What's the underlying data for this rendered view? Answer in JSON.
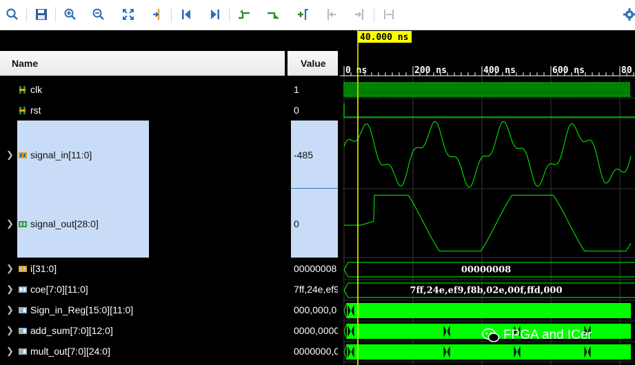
{
  "toolbar": {
    "buttons": [
      {
        "name": "search-icon"
      },
      {
        "name": "save-icon"
      },
      {
        "name": "zoom-in-icon"
      },
      {
        "name": "zoom-out-icon"
      },
      {
        "name": "zoom-fit-icon"
      },
      {
        "name": "go-to-cursor-icon"
      },
      {
        "name": "go-to-start-icon"
      },
      {
        "name": "go-to-end-icon"
      },
      {
        "name": "previous-transition-icon"
      },
      {
        "name": "next-transition-icon"
      },
      {
        "name": "add-marker-icon"
      },
      {
        "name": "previous-marker-icon"
      },
      {
        "name": "next-marker-icon"
      },
      {
        "name": "swap-cursors-icon"
      }
    ],
    "settings_icon": "gear-icon"
  },
  "columns": {
    "name_header": "Name",
    "value_header": "Value"
  },
  "signals": [
    {
      "label": "clk",
      "value": "1",
      "expandable": false,
      "icon": "bit-signal-icon"
    },
    {
      "label": "rst",
      "value": "0",
      "expandable": false,
      "icon": "bit-signal-icon"
    },
    {
      "label": "signal_in[11:0]",
      "value": "-485",
      "expandable": true,
      "icon": "bus-signal-icon",
      "selected": true
    },
    {
      "label": "signal_out[28:0]",
      "value": "0",
      "expandable": true,
      "icon": "bus-signal-icon",
      "selected": true
    },
    {
      "label": "i[31:0]",
      "value": "00000008",
      "expandable": true,
      "icon": "bus-signal-icon"
    },
    {
      "label": "coe[7:0][11:0]",
      "value": "7ff,24e,ef9",
      "expandable": true,
      "icon": "array-signal-icon"
    },
    {
      "label": "Sign_in_Reg[15:0][11:0]",
      "value": "000,000,0",
      "expandable": true,
      "icon": "array-signal-icon"
    },
    {
      "label": "add_sum[7:0][12:0]",
      "value": "0000,0000",
      "expandable": true,
      "icon": "array-signal-icon"
    },
    {
      "label": "mult_out[7:0][24:0]",
      "value": "0000000,0",
      "expandable": true,
      "icon": "array-signal-icon"
    }
  ],
  "waveform": {
    "cursor_label": "40.000 ns",
    "cursor_time_ns": 40,
    "time_ticks": [
      "0 ns",
      "200 ns",
      "400 ns",
      "600 ns",
      "80"
    ],
    "bus_values": {
      "i": "00000008",
      "coe": "7ff,24e,ef9,f8b,02e,00f,ffd,000"
    },
    "colors": {
      "wave": "#00ff00",
      "cursor": "#ffff00",
      "selection": "#c9dcf7"
    }
  },
  "watermark": {
    "text": "FPGA and ICer",
    "icon": "wechat-icon"
  }
}
